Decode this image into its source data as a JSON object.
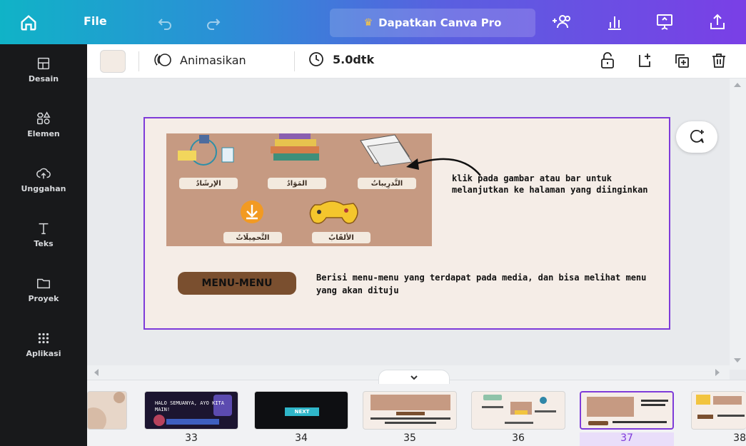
{
  "app": {
    "file_label": "File",
    "pro_label": "Dapatkan Canva Pro"
  },
  "sidebar": {
    "items": [
      {
        "label": "Desain",
        "icon": "layout-icon"
      },
      {
        "label": "Elemen",
        "icon": "shapes-icon"
      },
      {
        "label": "Unggahan",
        "icon": "cloud-upload-icon"
      },
      {
        "label": "Teks",
        "icon": "text-icon"
      },
      {
        "label": "Proyek",
        "icon": "folder-icon"
      },
      {
        "label": "Aplikasi",
        "icon": "apps-grid-icon"
      }
    ]
  },
  "toolbar": {
    "animate_label": "Animasikan",
    "duration_label": "5.0dtk",
    "swatch_color": "#f3ebe4"
  },
  "slide": {
    "menu_labels": [
      "الإرشَادُ",
      "المَوَادُ",
      "التَّدرِيباتُ",
      "التَّحمِيلَاتُ",
      "الألقَابُ"
    ],
    "note": "klik pada gambar atau bar untuk melanjutkan ke halaman yang diinginkan",
    "badge": "MENU-MENU",
    "description": "Berisi menu-menu yang terdapat pada media, dan bisa melihat menu yang akan dituju"
  },
  "filmstrip": {
    "pages": [
      "33",
      "34",
      "35",
      "36",
      "37",
      "38"
    ],
    "active_page": "37",
    "thumb33_text": "HALO SEMUANYA, AYO KITA MAIN!",
    "thumb34_text": "NEXT"
  },
  "colors": {
    "accent": "#7e3bd9",
    "sidebar_bg": "#18191b"
  }
}
